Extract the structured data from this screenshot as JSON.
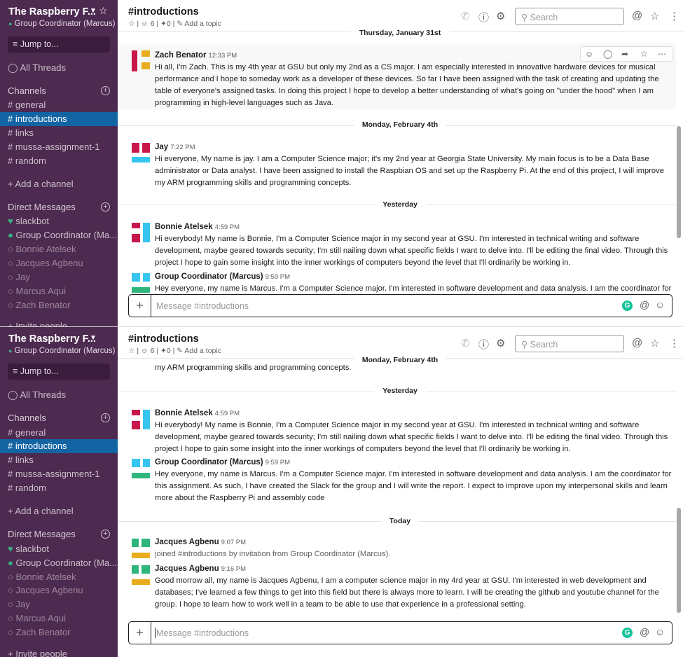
{
  "workspace": {
    "name": "The Raspberry F...",
    "user": "Group Coordinator (Marcus)"
  },
  "sidebar": {
    "jump": "Jump to...",
    "all_threads": "All Threads",
    "channels_header": "Channels",
    "channels": [
      "general",
      "introductions",
      "links",
      "mussa-assignment-1",
      "random"
    ],
    "add_channel": "Add a channel",
    "dm_header": "Direct Messages",
    "dms": [
      "slackbot",
      "Group Coordinator (Ma...",
      "Bonnie Atelsek",
      "Jacques Agbenu",
      "Jay",
      "Marcus Aqui",
      "Zach Benator"
    ],
    "invite": "Invite people"
  },
  "channel": {
    "title": "#introductions",
    "members": "6",
    "pins": "0",
    "topic": "Add a topic",
    "search_placeholder": "Search",
    "composer_placeholder": "Message #introductions"
  },
  "dates": {
    "jan31": "Thursday, January 31st",
    "feb4": "Monday, February 4th",
    "yesterday": "Yesterday",
    "today": "Today"
  },
  "messages": {
    "zach": {
      "author": "Zach Benator",
      "time": "12:33 PM",
      "text": "Hi all, I'm Zach. This is my 4th year at GSU but  only my 2nd as a CS major. I am especially interested in innovative hardware devices for musical performance and I hope to someday work as a developer of these devices. So far I have been assigned with the task of creating and updating the table of everyone's assigned tasks. In doing this project I hope to develop a better understanding of what's going on \"under the hood\" when I am programming in high-level languages such as Java."
    },
    "jay": {
      "author": "Jay",
      "time": "7:22 PM",
      "text": "Hi everyone, My name is jay. I am a Computer Science major; it's my 2nd year at Georgia State University. My main focus is to be a Data Base administrator or Data analyst. I have been assigned to install the Raspbian OS and set up the Raspberry Pi. At the end of this project, I will improve my ARM programming skills and programming concepts.",
      "tail": "my ARM programming skills and programming concepts."
    },
    "bonnie": {
      "author": "Bonnie Atelsek",
      "time": "4:59 PM",
      "text": "Hi everybody! My name is Bonnie, I'm a Computer Science major in my second year at GSU. I'm interested in technical writing and software development, maybe geared towards security; I'm still nailing down what specific fields I want to delve into. I'll be editing the final video. Through this project I hope to gain some insight into the inner workings of computers beyond the level that I'll ordinarily be working in."
    },
    "marcus": {
      "author": "Group Coordinator (Marcus)",
      "time": "9:59 PM",
      "text": "Hey everyone, my name is Marcus. I'm a Computer Science major. I'm interested in software development and data analysis. I am the coordinator for this assignment. As such, I have created the Slack for the group and I will write the report. I expect to improve upon my interpersonal skills and learn more about the Raspberry Pi and assembly code"
    },
    "jacques_join": {
      "author": "Jacques Agbenu",
      "time": "9:07 PM",
      "text": "joined #introductions by invitation from Group Coordinator (Marcus)."
    },
    "jacques": {
      "author": "Jacques Agbenu",
      "time": "9:16 PM",
      "text": "Good morrow all,  my name is Jacques Agbenu, I am a computer science major in my 4rd year at GSU. I'm interested in web development and databases; I've learned a few things to get into this field but there is always more to learn. I will be creating the github and youtube channel for the group. I hope to learn how to work well in a team to be able to use that experience in a professional setting."
    }
  },
  "colors": {
    "sidebar_bg": "#4d2a50",
    "active": "#1264a3",
    "presence": "#38b17e"
  }
}
